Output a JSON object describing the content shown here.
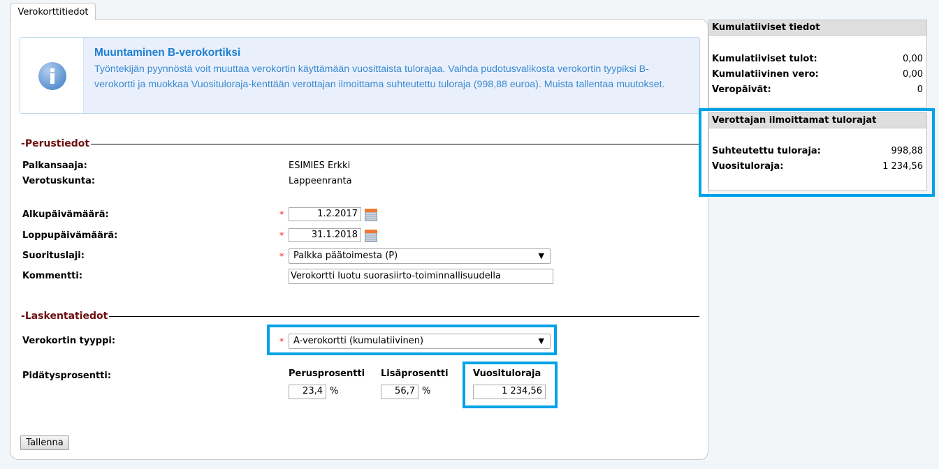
{
  "tab": {
    "label": "Verokorttitiedot"
  },
  "info": {
    "title": "Muuntaminen B-verokortiksi",
    "text": "Työntekijän pyynnöstä voit muuttaa verokortin käyttämään vuosittaista tulorajaa. Vaihda pudotusvalikosta verokortin tyypiksi B-verokortti ja muokkaa Vuosituloraja-kenttään verottajan ilmoittama suhteutettu tuloraja (998,88 euroa). Muista tallentaa muutokset."
  },
  "perustiedot": {
    "legend": "Perustiedot",
    "palkansaaja_label": "Palkansaaja:",
    "palkansaaja_value": "ESIMIES Erkki",
    "verotuskunta_label": "Verotuskunta:",
    "verotuskunta_value": "Lappeenranta",
    "alku_label": "Alkupäivämäärä:",
    "alku_value": "1.2.2017",
    "loppu_label": "Loppupäivämäärä:",
    "loppu_value": "31.1.2018",
    "suorituslaji_label": "Suorituslaji:",
    "suorituslaji_value": "Palkka päätoimesta (P)",
    "kommentti_label": "Kommentti:",
    "kommentti_value": "Verokortti luotu suorasiirto-toiminnallisuudella",
    "required_mark": "*"
  },
  "laskentatiedot": {
    "legend": "Laskentatiedot",
    "tyyppi_label": "Verokortin tyyppi:",
    "tyyppi_value": "A-verokortti (kumulatiivinen)",
    "pidatys_label": "Pidätysprosentti:",
    "perus_label": "Perusprosentti",
    "perus_value": "23,4",
    "lisa_label": "Lisäprosentti",
    "lisa_value": "56,7",
    "percent": "%",
    "vuosi_label": "Vuosituloraja",
    "vuosi_value": "1 234,56"
  },
  "save_label": "Tallenna",
  "sidebar": {
    "kumulatiiviset": {
      "title": "Kumulatiiviset tiedot",
      "rows": [
        {
          "label": "Kumulatiiviset tulot:",
          "value": "0,00"
        },
        {
          "label": "Kumulatiivinen vero:",
          "value": "0,00"
        },
        {
          "label": "Veropäivät:",
          "value": "0"
        }
      ]
    },
    "tulorajat": {
      "title": "Verottajan ilmoittamat tulorajat",
      "rows": [
        {
          "label": "Suhteutettu tuloraja:",
          "value": "998,88"
        },
        {
          "label": "Vuosituloraja:",
          "value": "1 234,56"
        }
      ]
    }
  },
  "colors": {
    "highlight": "#00a2e8",
    "legend": "#6b0f0f",
    "info_text": "#3a8ad4",
    "required": "#e22222"
  }
}
